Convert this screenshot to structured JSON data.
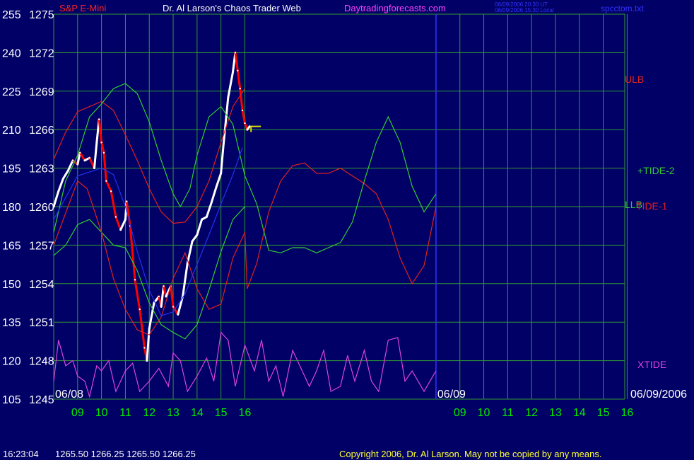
{
  "header": {
    "instrument": "S&P E-Mini",
    "title": "Dr. Al Larson's Chaos Trader Web",
    "site": "Daytradingforecasts.com",
    "stamp_line1": "06/09/2006 20:30 UT",
    "stamp_line2": "06/09/2006 15:30 Local",
    "filename": "spcctom.txt"
  },
  "footer": {
    "time": "16:23:04",
    "ohlc": "1265.50 1266.25 1265.50 1266.25",
    "copyright": "Copyright 2006, Dr. Al Larson. May not be copied by any means."
  },
  "colors": {
    "background": "#000066",
    "grid": "#339933",
    "day_divider": "#3333ff",
    "price_up": "#ffffff",
    "price_down": "#ff0000",
    "ulb": "#e02020",
    "llb": "#33cc33",
    "tide1": "#e02020",
    "tide2": "#33cc33",
    "xtide": "#dd44dd",
    "moving_avg": "#2233ee",
    "signal": "#dddd00",
    "x_labels": "#00ee00",
    "y_labels": "#ffffff",
    "title": "#ffffff",
    "instrument": "#ff2222",
    "site": "#ff44ff",
    "stamp": "#3333ff",
    "footer_left": "#ffffff",
    "footer_right": "#ffff33"
  },
  "chart_data": {
    "type": "line",
    "title": "S&P E-Mini",
    "y_left_ticks": [
      "255",
      "240",
      "225",
      "210",
      "195",
      "180",
      "165",
      "150",
      "135",
      "120",
      "105"
    ],
    "y_right_ticks": [
      "1275",
      "1272",
      "1269",
      "1266",
      "1263",
      "1260",
      "1257",
      "1254",
      "1251",
      "1248",
      "1245"
    ],
    "price_range": [
      1245,
      1275
    ],
    "index_range": [
      105,
      255
    ],
    "x_ticks": [
      "09",
      "10",
      "11",
      "12",
      "13",
      "14",
      "15",
      "16",
      "09",
      "10",
      "11",
      "12",
      "13",
      "14",
      "15",
      "16"
    ],
    "x_hours_range": [
      8.0,
      31.9
    ],
    "day_labels": [
      {
        "text": "06/08",
        "hour": 8.0
      },
      {
        "text": "06/09",
        "hour": 24.0
      },
      {
        "text": "06/09/2006",
        "hour": 30.5
      }
    ],
    "day_divider_hour": 24.0,
    "grid": true,
    "series": [
      {
        "name": "S&P E-Mini",
        "units": "price",
        "points": [
          [
            8.0,
            1260.0
          ],
          [
            8.2,
            1261.2
          ],
          [
            8.4,
            1262.2
          ],
          [
            8.6,
            1262.8
          ],
          [
            8.8,
            1263.6
          ],
          [
            9.0,
            1263.3
          ],
          [
            9.1,
            1264.2
          ],
          [
            9.3,
            1263.6
          ],
          [
            9.5,
            1263.8
          ],
          [
            9.7,
            1263.0
          ],
          [
            9.8,
            1265.0
          ],
          [
            9.9,
            1266.8
          ],
          [
            10.0,
            1265.0
          ],
          [
            10.1,
            1264.2
          ],
          [
            10.2,
            1262.0
          ],
          [
            10.4,
            1261.2
          ],
          [
            10.6,
            1259.2
          ],
          [
            10.8,
            1258.2
          ],
          [
            11.0,
            1259.0
          ],
          [
            11.05,
            1260.4
          ],
          [
            11.2,
            1258.5
          ],
          [
            11.4,
            1254.3
          ],
          [
            11.6,
            1252.0
          ],
          [
            11.8,
            1249.0
          ],
          [
            11.9,
            1248.0
          ],
          [
            12.0,
            1250.5
          ],
          [
            12.2,
            1252.5
          ],
          [
            12.4,
            1253.0
          ],
          [
            12.5,
            1252.2
          ],
          [
            12.6,
            1253.8
          ],
          [
            12.7,
            1253.0
          ],
          [
            12.9,
            1253.8
          ],
          [
            13.0,
            1252.2
          ],
          [
            13.2,
            1251.6
          ],
          [
            13.4,
            1253.0
          ],
          [
            13.6,
            1255.6
          ],
          [
            13.8,
            1257.3
          ],
          [
            14.0,
            1257.8
          ],
          [
            14.2,
            1259.0
          ],
          [
            14.4,
            1259.2
          ],
          [
            14.6,
            1260.3
          ],
          [
            14.8,
            1261.5
          ],
          [
            15.0,
            1262.6
          ],
          [
            15.1,
            1264.7
          ],
          [
            15.3,
            1268.5
          ],
          [
            15.5,
            1270.5
          ],
          [
            15.6,
            1272.0
          ],
          [
            15.7,
            1270.6
          ],
          [
            15.8,
            1269.2
          ],
          [
            15.9,
            1267.5
          ],
          [
            16.0,
            1266.5
          ],
          [
            16.1,
            1266.0
          ],
          [
            16.2,
            1266.25
          ]
        ]
      },
      {
        "name": "ULB",
        "units": "price",
        "points": [
          [
            8.0,
            1263.7
          ],
          [
            8.5,
            1265.8
          ],
          [
            9.0,
            1267.4
          ],
          [
            9.5,
            1267.8
          ],
          [
            10.0,
            1268.2
          ],
          [
            10.5,
            1267.5
          ],
          [
            11.0,
            1265.6
          ],
          [
            11.5,
            1263.6
          ],
          [
            12.0,
            1261.4
          ],
          [
            12.5,
            1259.6
          ],
          [
            13.0,
            1258.7
          ],
          [
            13.5,
            1258.8
          ],
          [
            14.0,
            1260.0
          ],
          [
            14.5,
            1262.0
          ],
          [
            15.0,
            1265.0
          ],
          [
            15.5,
            1267.8
          ],
          [
            16.0,
            1269.2
          ]
        ]
      },
      {
        "name": "LLB",
        "units": "price",
        "points": [
          [
            8.0,
            1256.2
          ],
          [
            8.5,
            1257.0
          ],
          [
            9.0,
            1258.6
          ],
          [
            9.5,
            1259.0
          ],
          [
            10.0,
            1258.0
          ],
          [
            10.5,
            1257.0
          ],
          [
            11.0,
            1256.8
          ],
          [
            11.5,
            1255.0
          ],
          [
            12.0,
            1252.5
          ],
          [
            12.5,
            1250.8
          ],
          [
            13.0,
            1250.2
          ],
          [
            13.5,
            1249.7
          ],
          [
            14.0,
            1250.8
          ],
          [
            14.5,
            1253.5
          ],
          [
            15.0,
            1256.5
          ],
          [
            15.5,
            1259.0
          ],
          [
            16.0,
            1260.0
          ]
        ]
      },
      {
        "name": "TIDE-1",
        "units": "index",
        "points": [
          [
            8.0,
            165
          ],
          [
            8.6,
            180
          ],
          [
            9.0,
            190
          ],
          [
            9.4,
            187
          ],
          [
            10.0,
            170
          ],
          [
            10.5,
            152
          ],
          [
            11.0,
            140
          ],
          [
            11.5,
            132
          ],
          [
            12.0,
            130
          ],
          [
            12.5,
            137
          ],
          [
            13.0,
            152
          ],
          [
            13.5,
            162
          ],
          [
            14.0,
            148
          ],
          [
            14.5,
            140
          ],
          [
            15.0,
            142
          ],
          [
            15.5,
            160
          ],
          [
            16.0,
            170
          ],
          [
            16.1,
            148
          ],
          [
            16.5,
            158
          ],
          [
            17.0,
            178
          ],
          [
            17.5,
            190
          ],
          [
            18.0,
            196
          ],
          [
            18.5,
            197
          ],
          [
            19.0,
            193
          ],
          [
            19.5,
            193
          ],
          [
            20.0,
            195
          ],
          [
            20.5,
            192
          ],
          [
            21.0,
            189
          ],
          [
            21.5,
            185
          ],
          [
            22.0,
            175
          ],
          [
            22.5,
            160
          ],
          [
            23.0,
            150
          ],
          [
            23.5,
            157
          ],
          [
            24.0,
            180
          ]
        ]
      },
      {
        "name": "+TIDE-2",
        "units": "index",
        "points": [
          [
            8.0,
            170
          ],
          [
            8.5,
            190
          ],
          [
            9.0,
            200
          ],
          [
            9.5,
            215
          ],
          [
            10.0,
            220
          ],
          [
            10.5,
            226
          ],
          [
            11.0,
            228
          ],
          [
            11.5,
            224
          ],
          [
            12.0,
            213
          ],
          [
            12.5,
            198
          ],
          [
            13.0,
            185
          ],
          [
            13.3,
            180
          ],
          [
            13.7,
            187
          ],
          [
            14.0,
            200
          ],
          [
            14.5,
            215
          ],
          [
            15.0,
            219
          ],
          [
            15.5,
            212
          ],
          [
            16.0,
            192
          ],
          [
            16.5,
            181
          ],
          [
            17.0,
            163
          ],
          [
            17.5,
            162
          ],
          [
            18.0,
            164
          ],
          [
            18.5,
            164
          ],
          [
            19.0,
            162
          ],
          [
            19.5,
            164
          ],
          [
            20.0,
            166
          ],
          [
            20.5,
            174
          ],
          [
            21.0,
            190
          ],
          [
            21.5,
            205
          ],
          [
            22.0,
            215
          ],
          [
            22.5,
            205
          ],
          [
            23.0,
            188
          ],
          [
            23.5,
            178
          ],
          [
            24.0,
            185
          ]
        ]
      },
      {
        "name": "XTIDE",
        "units": "index",
        "points": [
          [
            8.0,
            112
          ],
          [
            8.2,
            128
          ],
          [
            8.5,
            118
          ],
          [
            8.8,
            120
          ],
          [
            9.0,
            114
          ],
          [
            9.3,
            112
          ],
          [
            9.5,
            106
          ],
          [
            9.8,
            118
          ],
          [
            10.0,
            116
          ],
          [
            10.3,
            120
          ],
          [
            10.6,
            108
          ],
          [
            11.0,
            116
          ],
          [
            11.3,
            119
          ],
          [
            11.6,
            108
          ],
          [
            12.0,
            112
          ],
          [
            12.4,
            117
          ],
          [
            12.8,
            110
          ],
          [
            13.0,
            123
          ],
          [
            13.3,
            120
          ],
          [
            13.6,
            108
          ],
          [
            14.0,
            114
          ],
          [
            14.4,
            121
          ],
          [
            14.7,
            112
          ],
          [
            15.0,
            131
          ],
          [
            15.3,
            128
          ],
          [
            15.6,
            110
          ],
          [
            16.0,
            126
          ],
          [
            16.4,
            116
          ],
          [
            16.7,
            128
          ],
          [
            17.0,
            112
          ],
          [
            17.3,
            118
          ],
          [
            17.6,
            106
          ],
          [
            18.0,
            124
          ],
          [
            18.4,
            116
          ],
          [
            18.7,
            110
          ],
          [
            19.0,
            116
          ],
          [
            19.3,
            124
          ],
          [
            19.6,
            108
          ],
          [
            20.0,
            110
          ],
          [
            20.3,
            122
          ],
          [
            20.6,
            112
          ],
          [
            21.0,
            124
          ],
          [
            21.3,
            112
          ],
          [
            21.6,
            108
          ],
          [
            22.0,
            128
          ],
          [
            22.4,
            129
          ],
          [
            22.7,
            112
          ],
          [
            23.0,
            116
          ],
          [
            23.5,
            108
          ],
          [
            24.0,
            116
          ]
        ]
      },
      {
        "name": "MA",
        "units": "price",
        "points": [
          [
            8.0,
            1259.0
          ],
          [
            9.0,
            1262.4
          ],
          [
            10.0,
            1263.0
          ],
          [
            10.5,
            1262.5
          ],
          [
            11.0,
            1260.0
          ],
          [
            11.5,
            1256.5
          ],
          [
            12.0,
            1253.5
          ],
          [
            12.5,
            1251.5
          ],
          [
            13.0,
            1251.8
          ],
          [
            13.5,
            1253.2
          ],
          [
            14.0,
            1255.5
          ],
          [
            14.5,
            1257.8
          ],
          [
            15.0,
            1260.2
          ],
          [
            15.5,
            1262.5
          ],
          [
            15.9,
            1264.6
          ]
        ]
      }
    ],
    "series_labels": [
      {
        "text": "ULB",
        "series": "ULB"
      },
      {
        "text": "+TIDE-2",
        "series": "+TIDE-2"
      },
      {
        "text": "LLB",
        "series": "LLB"
      },
      {
        "text": "TIDE-1",
        "series": "TIDE-1"
      },
      {
        "text": "XTIDE",
        "series": "XTIDE"
      }
    ]
  }
}
